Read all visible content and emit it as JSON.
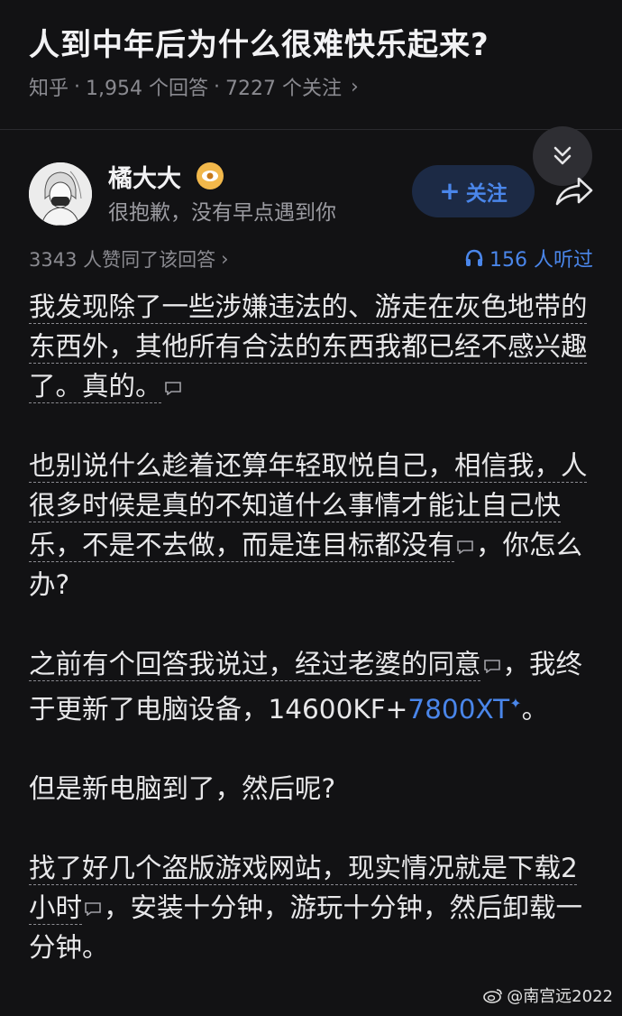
{
  "question": {
    "title": "人到中年后为什么很难快乐起来?",
    "source": "知乎",
    "answer_count": "1,954 个回答",
    "follow_count": "7227 个关注"
  },
  "author": {
    "name": "橘大大",
    "bio": "很抱歉，没有早点遇到你",
    "follow_label": "关注"
  },
  "stats": {
    "likes": "3343 人赞同了该回答",
    "listens": "156 人听过"
  },
  "answer": {
    "p1a": "我发现除了一些涉嫌违法的、游走在灰色地带的东西外，其他所有合法的东西我都已经不感兴趣了。真的。",
    "p2a": "也别说什么趁着还算年轻取悦自己，相信我，人很多时候是真的不知道什么事情才能让自己快乐，不是不去做，而是连目标都没有",
    "p2b": "，你怎么办?",
    "p3a": "之前有个回答我说过，经过老婆的同意",
    "p3b": "，我终于更新了电脑设备，14600KF+",
    "p3link": "7800XT",
    "p3c": "。",
    "p4": "但是新电脑到了，然后呢?",
    "p5a": "找了好几个盗版游戏网站，现实情况就是下载2小时",
    "p5b": "，安装十分钟，游玩十分钟，然后卸载一分钟。"
  },
  "watermark": "@南宫远2022",
  "icons": {
    "collapse": "double-chevron-down-icon",
    "share": "share-arrow-icon",
    "headphones": "headphones-icon",
    "badge": "eye-badge-icon",
    "comment": "comment-bubble-icon",
    "weibo": "weibo-logo-icon"
  },
  "colors": {
    "background": "#121214",
    "accent": "#4a86ea",
    "muted": "#8a8a90",
    "badge": "#f2b84b"
  }
}
